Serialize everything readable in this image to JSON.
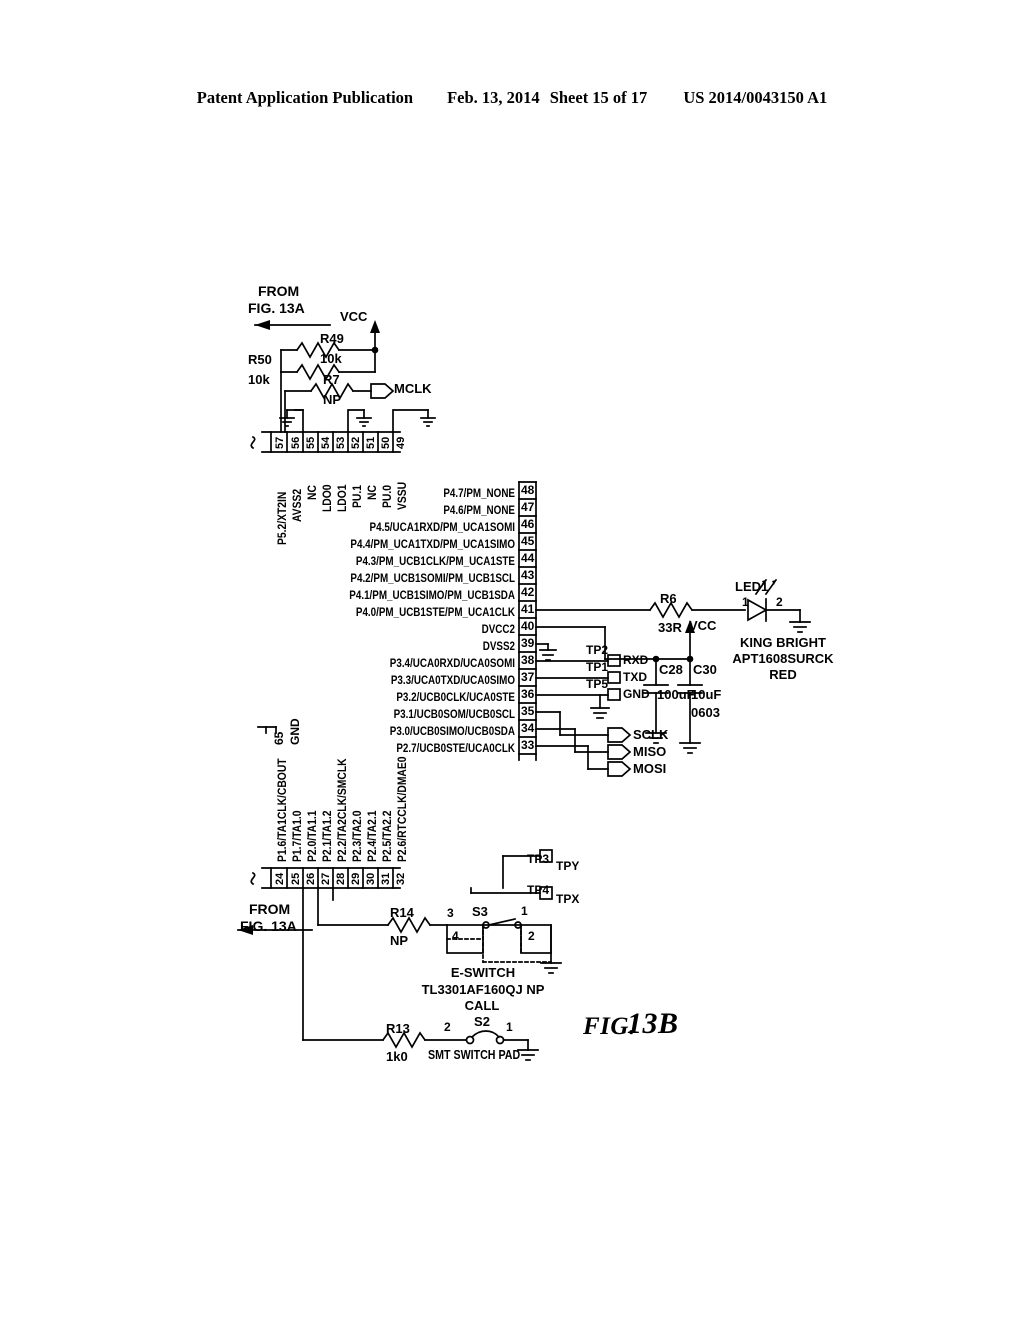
{
  "page_header": {
    "left": "Patent Application Publication",
    "date": "Feb. 13, 2014",
    "sheet": "Sheet 15 of 17",
    "patent_number": "US 2014/0043150 A1"
  },
  "figure": {
    "label": "FIG.",
    "number": "13B",
    "from_top": [
      "FROM",
      "FIG. 13A"
    ],
    "from_bottom": [
      "FROM",
      "FIG. 13A"
    ]
  },
  "power": {
    "vcc_top": "VCC",
    "vcc_led": "VCC"
  },
  "resistors": [
    {
      "ref": "R49",
      "value": "10k"
    },
    {
      "ref": "R50",
      "value": "10k"
    },
    {
      "ref": "R7",
      "value": "NP"
    },
    {
      "ref": "R6",
      "value": "33R"
    },
    {
      "ref": "R14",
      "value": "NP"
    },
    {
      "ref": "R13",
      "value": "1k0"
    }
  ],
  "capacitors": [
    {
      "ref": "C28",
      "value": "100uF",
      "package": ""
    },
    {
      "ref": "C30",
      "value": "10uF",
      "package": "0603"
    }
  ],
  "led": {
    "ref": "LED1",
    "pin_a": "1",
    "pin_k": "2",
    "manufacturer": "KING BRIGHT",
    "part": "APT1608SURCK",
    "color": "RED"
  },
  "nets": {
    "mclk": "MCLK",
    "sclk": "SCLK",
    "miso": "MISO",
    "mosi": "MOSI",
    "tpy": "TPY",
    "tpx": "TPX"
  },
  "test_points": [
    {
      "ref": "TP2",
      "net": "RXD"
    },
    {
      "ref": "TP1",
      "net": "TXD"
    },
    {
      "ref": "TP5",
      "net": "GND"
    },
    {
      "ref": "TP3",
      "net": "TPY"
    },
    {
      "ref": "TP4",
      "net": "TPX"
    }
  ],
  "top_pins": [
    {
      "num": "57",
      "label": "P5.2/XT2IN"
    },
    {
      "num": "56",
      "label": "AVSS2"
    },
    {
      "num": "55",
      "label": "NC"
    },
    {
      "num": "54",
      "label": "LDO0"
    },
    {
      "num": "53",
      "label": "LDO1"
    },
    {
      "num": "52",
      "label": "PU.1"
    },
    {
      "num": "51",
      "label": "NC"
    },
    {
      "num": "50",
      "label": "PU.0"
    },
    {
      "num": "49",
      "label": "VSSU"
    }
  ],
  "right_pins": [
    {
      "num": "48",
      "label": "P4.7/PM_NONE"
    },
    {
      "num": "47",
      "label": "P4.6/PM_NONE"
    },
    {
      "num": "46",
      "label": "P4.5/UCA1RXD/PM_UCA1SOMI"
    },
    {
      "num": "45",
      "label": "P4.4/PM_UCA1TXD/PM_UCA1SIMO"
    },
    {
      "num": "44",
      "label": "P4.3/PM_UCB1CLK/PM_UCA1STE"
    },
    {
      "num": "43",
      "label": "P4.2/PM_UCB1SOMI/PM_UCB1SCL"
    },
    {
      "num": "42",
      "label": "P4.1/PM_UCB1SIMO/PM_UCB1SDA"
    },
    {
      "num": "41",
      "label": "P4.0/PM_UCB1STE/PM_UCA1CLK"
    },
    {
      "num": "40",
      "label": "DVCC2"
    },
    {
      "num": "39",
      "label": "DVSS2"
    },
    {
      "num": "38",
      "label": "P3.4/UCA0RXD/UCA0SOMI"
    },
    {
      "num": "37",
      "label": "P3.3/UCA0TXD/UCA0SIMO"
    },
    {
      "num": "36",
      "label": "P3.2/UCB0CLK/UCA0STE"
    },
    {
      "num": "35",
      "label": "P3.1/UCB0SOM/UCB0SCL"
    },
    {
      "num": "34",
      "label": "P3.0/UCB0SIMO/UCB0SDA"
    },
    {
      "num": "33",
      "label": "P2.7/UCB0STE/UCA0CLK"
    }
  ],
  "bottom_pins": [
    {
      "num": "24",
      "label": "P1.6/TA1CLK/CBOUT"
    },
    {
      "num": "25",
      "label": "P1.7/TA1.0"
    },
    {
      "num": "26",
      "label": "P2.0/TA1.1"
    },
    {
      "num": "27",
      "label": "P2.1/TA1.2"
    },
    {
      "num": "28",
      "label": "P2.2/TA2CLK/SMCLK"
    },
    {
      "num": "29",
      "label": "P2.3/TA2.0"
    },
    {
      "num": "30",
      "label": "P2.4/TA2.1"
    },
    {
      "num": "31",
      "label": "P2.5/TA2.2"
    },
    {
      "num": "32",
      "label": "P2.6/RTCCLK/DMAE0"
    }
  ],
  "gnd_pin": {
    "num": "65",
    "label": "GND"
  },
  "switches": [
    {
      "ref": "S3",
      "pins": [
        "3",
        "4",
        "1",
        "2"
      ],
      "type": "E-SWITCH",
      "part": "TL3301AF160QJ NP",
      "name": ""
    },
    {
      "ref": "S2",
      "pins": [
        "2",
        "1"
      ],
      "name": "CALL",
      "type": "SMT SWITCH PAD",
      "part": ""
    }
  ]
}
